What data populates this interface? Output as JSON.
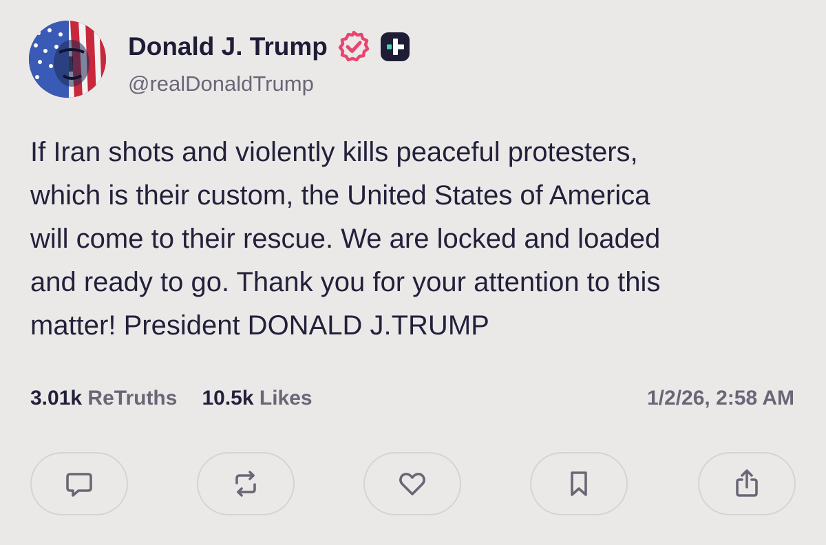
{
  "author": {
    "display_name": "Donald J. Trump",
    "handle": "@realDonaldTrump",
    "verified_badge_color": "#e8456f",
    "plus_badge_color": "#1f1d36"
  },
  "post": {
    "text": "If Iran shots and violently kills peaceful protesters,\nwhich is their custom, the United States of America\nwill come to their rescue. We are locked and loaded\nand ready to go. Thank you for your attention to this\nmatter! President DONALD J.TRUMP"
  },
  "stats": {
    "retruths_count": "3.01k",
    "retruths_label": "ReTruths",
    "likes_count": "10.5k",
    "likes_label": "Likes",
    "timestamp": "1/2/26, 2:58 AM"
  },
  "actions": [
    {
      "icon": "reply-icon"
    },
    {
      "icon": "retruth-icon"
    },
    {
      "icon": "like-icon"
    },
    {
      "icon": "bookmark-icon"
    },
    {
      "icon": "share-icon"
    }
  ],
  "colors": {
    "background": "#ebe9e8",
    "text": "#23213a",
    "muted": "#6a6676",
    "button_border": "#d6d3d4"
  }
}
